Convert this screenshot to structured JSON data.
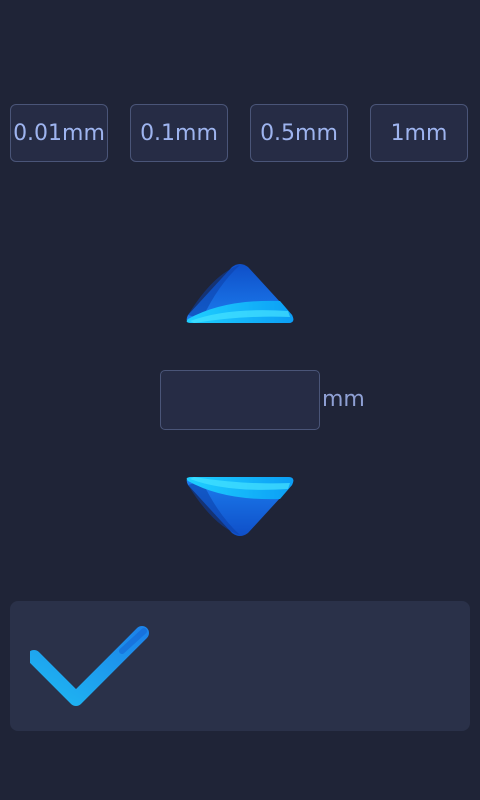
{
  "step_buttons": [
    {
      "label": "0.01mm"
    },
    {
      "label": "0.1mm"
    },
    {
      "label": "0.5mm"
    },
    {
      "label": "1mm"
    }
  ],
  "move": {
    "up_icon": "triangle-up-icon",
    "down_icon": "triangle-down-icon"
  },
  "distance_input": {
    "value": "",
    "placeholder": "",
    "unit": "mm"
  },
  "confirm": {
    "icon": "checkmark-icon"
  },
  "colors": {
    "background": "#1f2437",
    "button_border": "#4a5578",
    "button_text": "#9eb4ef",
    "accent": "#18a8f0",
    "panel": "#2a3149"
  }
}
